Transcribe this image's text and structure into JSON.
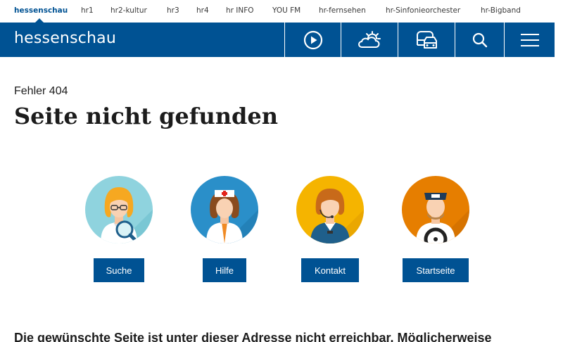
{
  "network_nav": {
    "items": [
      {
        "label": "hessenschau"
      },
      {
        "label": "hr1"
      },
      {
        "label": "hr2-kultur"
      },
      {
        "label": "hr3"
      },
      {
        "label": "hr4"
      },
      {
        "label": "hr INFO"
      },
      {
        "label": "YOU FM"
      },
      {
        "label": "hr-fernsehen"
      },
      {
        "label": "hr-Sinfonieorchester"
      },
      {
        "label": "hr-Bigband"
      }
    ]
  },
  "header": {
    "logo_text": "hessenschau",
    "icons": [
      "play-icon",
      "weather-icon",
      "traffic-icon",
      "search-icon",
      "menu-icon"
    ]
  },
  "error": {
    "code": "Fehler 404",
    "title": "Seite nicht gefunden"
  },
  "help_cards": [
    {
      "label": "Suche",
      "icon": "searcher-avatar-icon"
    },
    {
      "label": "Hilfe",
      "icon": "nurse-avatar-icon"
    },
    {
      "label": "Kontakt",
      "icon": "operator-avatar-icon"
    },
    {
      "label": "Startseite",
      "icon": "driver-avatar-icon"
    }
  ],
  "message": "Die gewünschte Seite ist unter dieser Adresse nicht erreichbar. Möglicherweise",
  "colors": {
    "brand_blue": "#005293",
    "avatar_bg_1": "#8fd3de",
    "avatar_bg_2": "#2a8fc9",
    "avatar_bg_3": "#f5b400",
    "avatar_bg_4": "#e67e00"
  }
}
